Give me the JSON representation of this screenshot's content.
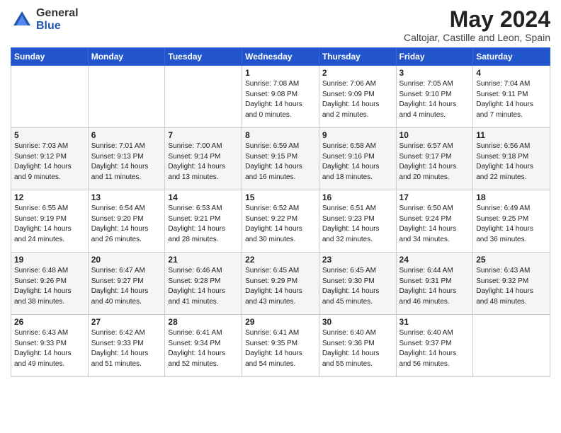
{
  "header": {
    "logo_general": "General",
    "logo_blue": "Blue",
    "month_title": "May 2024",
    "location": "Caltojar, Castille and Leon, Spain"
  },
  "days_of_week": [
    "Sunday",
    "Monday",
    "Tuesday",
    "Wednesday",
    "Thursday",
    "Friday",
    "Saturday"
  ],
  "weeks": [
    [
      {
        "day": "",
        "info": ""
      },
      {
        "day": "",
        "info": ""
      },
      {
        "day": "",
        "info": ""
      },
      {
        "day": "1",
        "info": "Sunrise: 7:08 AM\nSunset: 9:08 PM\nDaylight: 14 hours\nand 0 minutes."
      },
      {
        "day": "2",
        "info": "Sunrise: 7:06 AM\nSunset: 9:09 PM\nDaylight: 14 hours\nand 2 minutes."
      },
      {
        "day": "3",
        "info": "Sunrise: 7:05 AM\nSunset: 9:10 PM\nDaylight: 14 hours\nand 4 minutes."
      },
      {
        "day": "4",
        "info": "Sunrise: 7:04 AM\nSunset: 9:11 PM\nDaylight: 14 hours\nand 7 minutes."
      }
    ],
    [
      {
        "day": "5",
        "info": "Sunrise: 7:03 AM\nSunset: 9:12 PM\nDaylight: 14 hours\nand 9 minutes."
      },
      {
        "day": "6",
        "info": "Sunrise: 7:01 AM\nSunset: 9:13 PM\nDaylight: 14 hours\nand 11 minutes."
      },
      {
        "day": "7",
        "info": "Sunrise: 7:00 AM\nSunset: 9:14 PM\nDaylight: 14 hours\nand 13 minutes."
      },
      {
        "day": "8",
        "info": "Sunrise: 6:59 AM\nSunset: 9:15 PM\nDaylight: 14 hours\nand 16 minutes."
      },
      {
        "day": "9",
        "info": "Sunrise: 6:58 AM\nSunset: 9:16 PM\nDaylight: 14 hours\nand 18 minutes."
      },
      {
        "day": "10",
        "info": "Sunrise: 6:57 AM\nSunset: 9:17 PM\nDaylight: 14 hours\nand 20 minutes."
      },
      {
        "day": "11",
        "info": "Sunrise: 6:56 AM\nSunset: 9:18 PM\nDaylight: 14 hours\nand 22 minutes."
      }
    ],
    [
      {
        "day": "12",
        "info": "Sunrise: 6:55 AM\nSunset: 9:19 PM\nDaylight: 14 hours\nand 24 minutes."
      },
      {
        "day": "13",
        "info": "Sunrise: 6:54 AM\nSunset: 9:20 PM\nDaylight: 14 hours\nand 26 minutes."
      },
      {
        "day": "14",
        "info": "Sunrise: 6:53 AM\nSunset: 9:21 PM\nDaylight: 14 hours\nand 28 minutes."
      },
      {
        "day": "15",
        "info": "Sunrise: 6:52 AM\nSunset: 9:22 PM\nDaylight: 14 hours\nand 30 minutes."
      },
      {
        "day": "16",
        "info": "Sunrise: 6:51 AM\nSunset: 9:23 PM\nDaylight: 14 hours\nand 32 minutes."
      },
      {
        "day": "17",
        "info": "Sunrise: 6:50 AM\nSunset: 9:24 PM\nDaylight: 14 hours\nand 34 minutes."
      },
      {
        "day": "18",
        "info": "Sunrise: 6:49 AM\nSunset: 9:25 PM\nDaylight: 14 hours\nand 36 minutes."
      }
    ],
    [
      {
        "day": "19",
        "info": "Sunrise: 6:48 AM\nSunset: 9:26 PM\nDaylight: 14 hours\nand 38 minutes."
      },
      {
        "day": "20",
        "info": "Sunrise: 6:47 AM\nSunset: 9:27 PM\nDaylight: 14 hours\nand 40 minutes."
      },
      {
        "day": "21",
        "info": "Sunrise: 6:46 AM\nSunset: 9:28 PM\nDaylight: 14 hours\nand 41 minutes."
      },
      {
        "day": "22",
        "info": "Sunrise: 6:45 AM\nSunset: 9:29 PM\nDaylight: 14 hours\nand 43 minutes."
      },
      {
        "day": "23",
        "info": "Sunrise: 6:45 AM\nSunset: 9:30 PM\nDaylight: 14 hours\nand 45 minutes."
      },
      {
        "day": "24",
        "info": "Sunrise: 6:44 AM\nSunset: 9:31 PM\nDaylight: 14 hours\nand 46 minutes."
      },
      {
        "day": "25",
        "info": "Sunrise: 6:43 AM\nSunset: 9:32 PM\nDaylight: 14 hours\nand 48 minutes."
      }
    ],
    [
      {
        "day": "26",
        "info": "Sunrise: 6:43 AM\nSunset: 9:33 PM\nDaylight: 14 hours\nand 49 minutes."
      },
      {
        "day": "27",
        "info": "Sunrise: 6:42 AM\nSunset: 9:33 PM\nDaylight: 14 hours\nand 51 minutes."
      },
      {
        "day": "28",
        "info": "Sunrise: 6:41 AM\nSunset: 9:34 PM\nDaylight: 14 hours\nand 52 minutes."
      },
      {
        "day": "29",
        "info": "Sunrise: 6:41 AM\nSunset: 9:35 PM\nDaylight: 14 hours\nand 54 minutes."
      },
      {
        "day": "30",
        "info": "Sunrise: 6:40 AM\nSunset: 9:36 PM\nDaylight: 14 hours\nand 55 minutes."
      },
      {
        "day": "31",
        "info": "Sunrise: 6:40 AM\nSunset: 9:37 PM\nDaylight: 14 hours\nand 56 minutes."
      },
      {
        "day": "",
        "info": ""
      }
    ]
  ]
}
